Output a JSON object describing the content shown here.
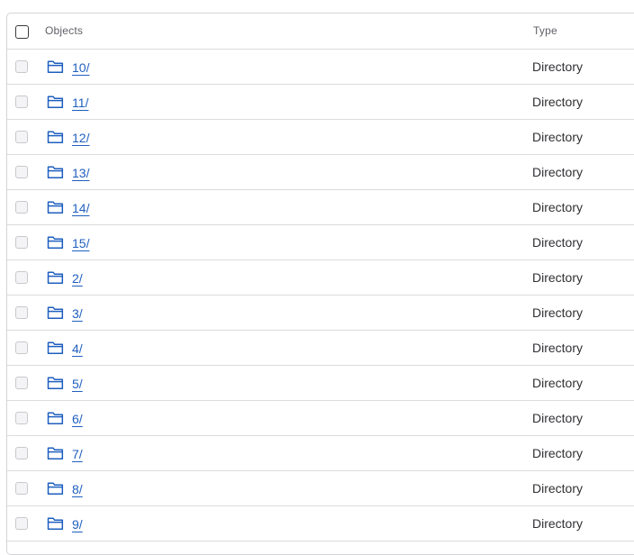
{
  "table": {
    "header": {
      "objects_label": "Objects",
      "type_label": "Type"
    },
    "rows": [
      {
        "name": "10/",
        "type": "Directory",
        "icon": "folder-icon"
      },
      {
        "name": "11/",
        "type": "Directory",
        "icon": "folder-icon"
      },
      {
        "name": "12/",
        "type": "Directory",
        "icon": "folder-icon"
      },
      {
        "name": "13/",
        "type": "Directory",
        "icon": "folder-icon"
      },
      {
        "name": "14/",
        "type": "Directory",
        "icon": "folder-icon"
      },
      {
        "name": "15/",
        "type": "Directory",
        "icon": "folder-icon"
      },
      {
        "name": "2/",
        "type": "Directory",
        "icon": "folder-icon"
      },
      {
        "name": "3/",
        "type": "Directory",
        "icon": "folder-icon"
      },
      {
        "name": "4/",
        "type": "Directory",
        "icon": "folder-icon"
      },
      {
        "name": "5/",
        "type": "Directory",
        "icon": "folder-icon"
      },
      {
        "name": "6/",
        "type": "Directory",
        "icon": "folder-icon"
      },
      {
        "name": "7/",
        "type": "Directory",
        "icon": "folder-icon"
      },
      {
        "name": "8/",
        "type": "Directory",
        "icon": "folder-icon"
      },
      {
        "name": "9/",
        "type": "Directory",
        "icon": "folder-icon"
      }
    ]
  },
  "colors": {
    "link": "#1f5fbf",
    "folder_icon": "#1f5fbf",
    "border": "#dcdcdf"
  }
}
